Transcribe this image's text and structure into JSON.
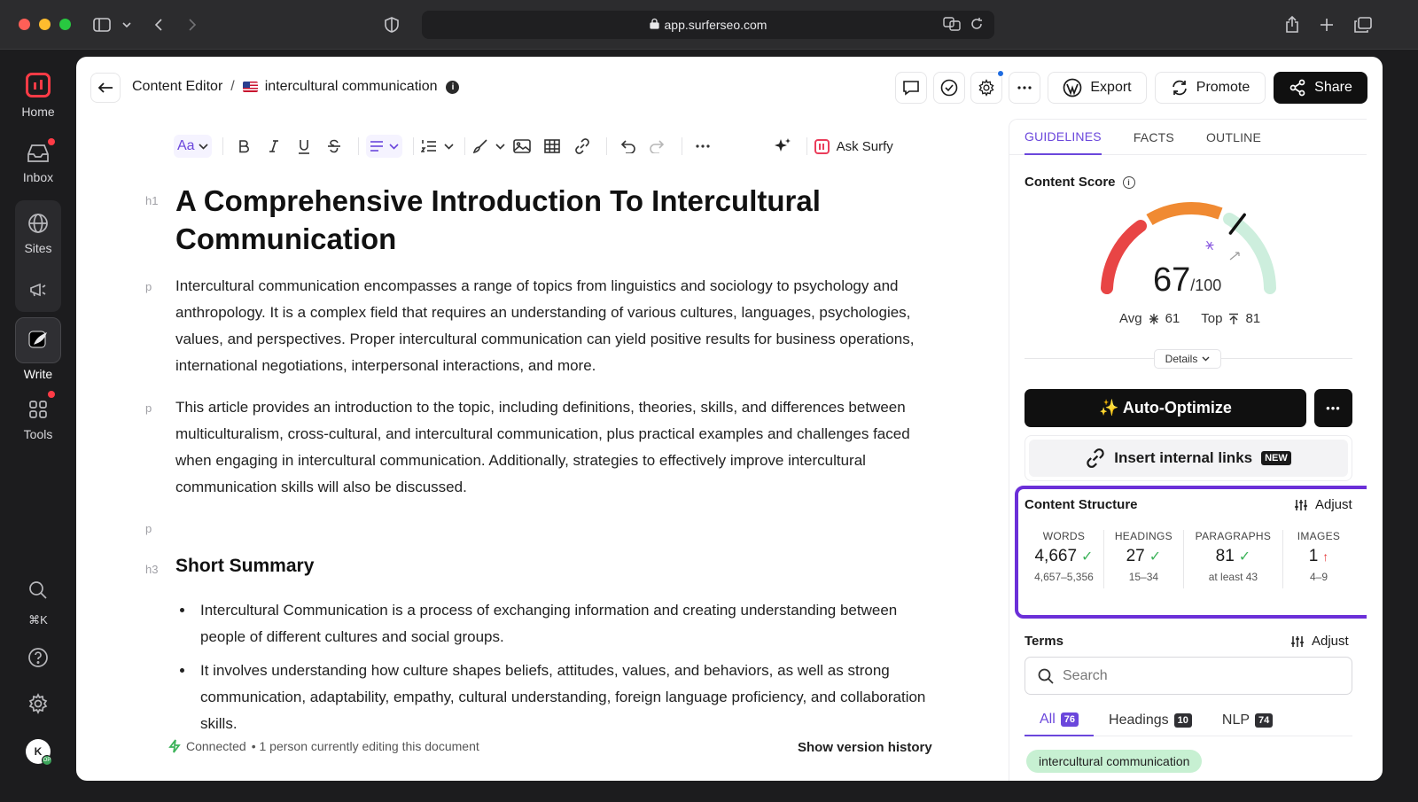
{
  "browser": {
    "url": "app.surferseo.com"
  },
  "rail": {
    "home": "Home",
    "inbox": "Inbox",
    "sites": "Sites",
    "write": "Write",
    "tools": "Tools",
    "shortcut": "⌘K",
    "avatar_initial": "K",
    "avatar_badge": "OP"
  },
  "header": {
    "breadcrumb_root": "Content Editor",
    "breadcrumb_sep": "/",
    "doc_title": "intercultural communication",
    "info_glyph": "i",
    "export_label": "Export",
    "promote_label": "Promote",
    "share_label": "Share"
  },
  "toolbar": {
    "font_label": "Aa",
    "ask_surfy": "Ask Surfy"
  },
  "document": {
    "tag_h1": "h1",
    "tag_p": "p",
    "tag_h3": "h3",
    "h1": "A Comprehensive Introduction To Intercultural Communication",
    "p1": "Intercultural communication encompasses a range of topics from linguistics and sociology to psychology and anthropology. It is a complex field that requires an understanding of various cultures, languages, psychologies, values, and perspectives. Proper intercultural communication can yield positive results for business operations, international negotiations, interpersonal interactions, and more.",
    "p2": "This article provides an introduction to the topic, including definitions, theories, skills, and differences between multiculturalism, cross-cultural, and intercultural communication, plus practical examples and challenges faced when engaging in intercultural communication. Additionally, strategies to effectively improve intercultural communication skills will also be discussed.",
    "h3": "Short Summary",
    "bullets": [
      "Intercultural Communication is a process of exchanging information and creating understanding between people of different cultures and social groups.",
      "It involves understanding how culture shapes beliefs, attitudes, values, and behaviors, as well as strong communication, adaptability, empathy, cultural understanding, foreign language proficiency, and collaboration skills."
    ]
  },
  "status": {
    "connected": "Connected",
    "editing": "• 1 person currently editing this document",
    "version_history": "Show version history"
  },
  "panel": {
    "tabs": [
      "GUIDELINES",
      "FACTS",
      "OUTLINE"
    ],
    "content_score_title": "Content Score",
    "score": "67",
    "score_max": "/100",
    "score_value": 67,
    "avg_label": "Avg",
    "avg_value": "61",
    "top_label": "Top",
    "top_value": "81",
    "details_label": "Details",
    "auto_optimize": "✨ Auto-Optimize",
    "more_glyph": "•••",
    "insert_links": "Insert internal links",
    "new_badge": "NEW",
    "structure_title": "Content Structure",
    "adjust_label": "Adjust",
    "metrics": [
      {
        "label": "WORDS",
        "value": "4,667",
        "status": "✓",
        "range": "4,657–5,356"
      },
      {
        "label": "HEADINGS",
        "value": "27",
        "status": "✓",
        "range": "15–34"
      },
      {
        "label": "PARAGRAPHS",
        "value": "81",
        "status": "✓",
        "range": "at least 43"
      },
      {
        "label": "IMAGES",
        "value": "1",
        "status": "↑",
        "range": "4–9"
      }
    ],
    "terms_title": "Terms",
    "search_placeholder": "Search",
    "filters": [
      {
        "label": "All",
        "count": "76"
      },
      {
        "label": "Headings",
        "count": "10"
      },
      {
        "label": "NLP",
        "count": "74"
      }
    ],
    "term_chip": "intercultural communication"
  },
  "colors": {
    "accent": "#6b47dc",
    "highlight_border": "#6b2fd8",
    "gauge_red": "#e84545",
    "gauge_orange": "#f08a32",
    "gauge_green": "#cdeedd",
    "ok_green": "#3db35a"
  }
}
